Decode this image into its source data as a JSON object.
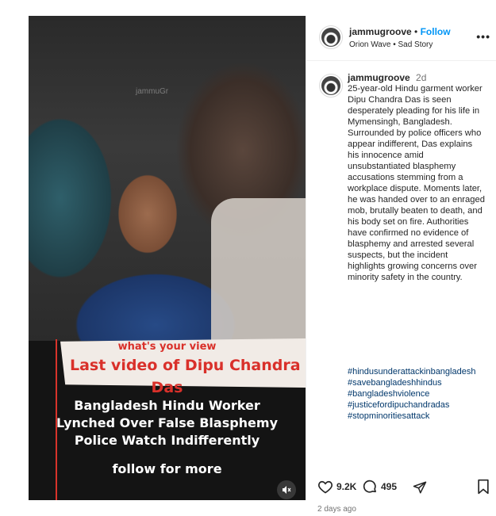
{
  "media": {
    "watermark": "jammuGr",
    "overlay_subtitle": "what's your view",
    "overlay_title_line1": "Last video of Dipu Chandra",
    "overlay_title_line2": "Das",
    "headline_lines": [
      "Bangladesh Hindu Worker",
      "Lynched Over False Blasphemy",
      "Police Watch Indifferently"
    ],
    "follow_text": "follow for more"
  },
  "header": {
    "username": "jammugroove",
    "separator": "•",
    "follow_label": "Follow",
    "audio": "Orion Wave • Sad Story"
  },
  "caption": {
    "username": "jammugroove",
    "time": "2d",
    "text": "25-year-old Hindu garment worker Dipu Chandra Das is seen desperately pleading for his life in Mymensingh, Bangladesh. Surrounded by police officers who appear indifferent, Das explains his innocence amid unsubstantiated blasphemy accusations stemming from a workplace dispute. Moments later, he was handed over to an enraged mob, brutally beaten to death, and his body set on fire. Authorities have confirmed no evidence of blasphemy and arrested several suspects, but the incident highlights growing concerns over minority safety in the country.",
    "hashtags": [
      "#hindusunderattackinbangladesh",
      "#savebangladeshhindus",
      "#bangladeshviolence",
      "#justicefordipuchandradas",
      "#stopminoritiesattack"
    ]
  },
  "actions": {
    "likes": "9.2K",
    "comments": "495",
    "posted": "2 days ago"
  },
  "colors": {
    "accent_link": "#0095f6",
    "hashtag": "#00376b",
    "overlay_red": "#d9302a"
  },
  "icons": [
    "heart-icon",
    "comment-icon",
    "share-icon",
    "bookmark-icon",
    "more-icon",
    "speaker-muted-icon"
  ]
}
